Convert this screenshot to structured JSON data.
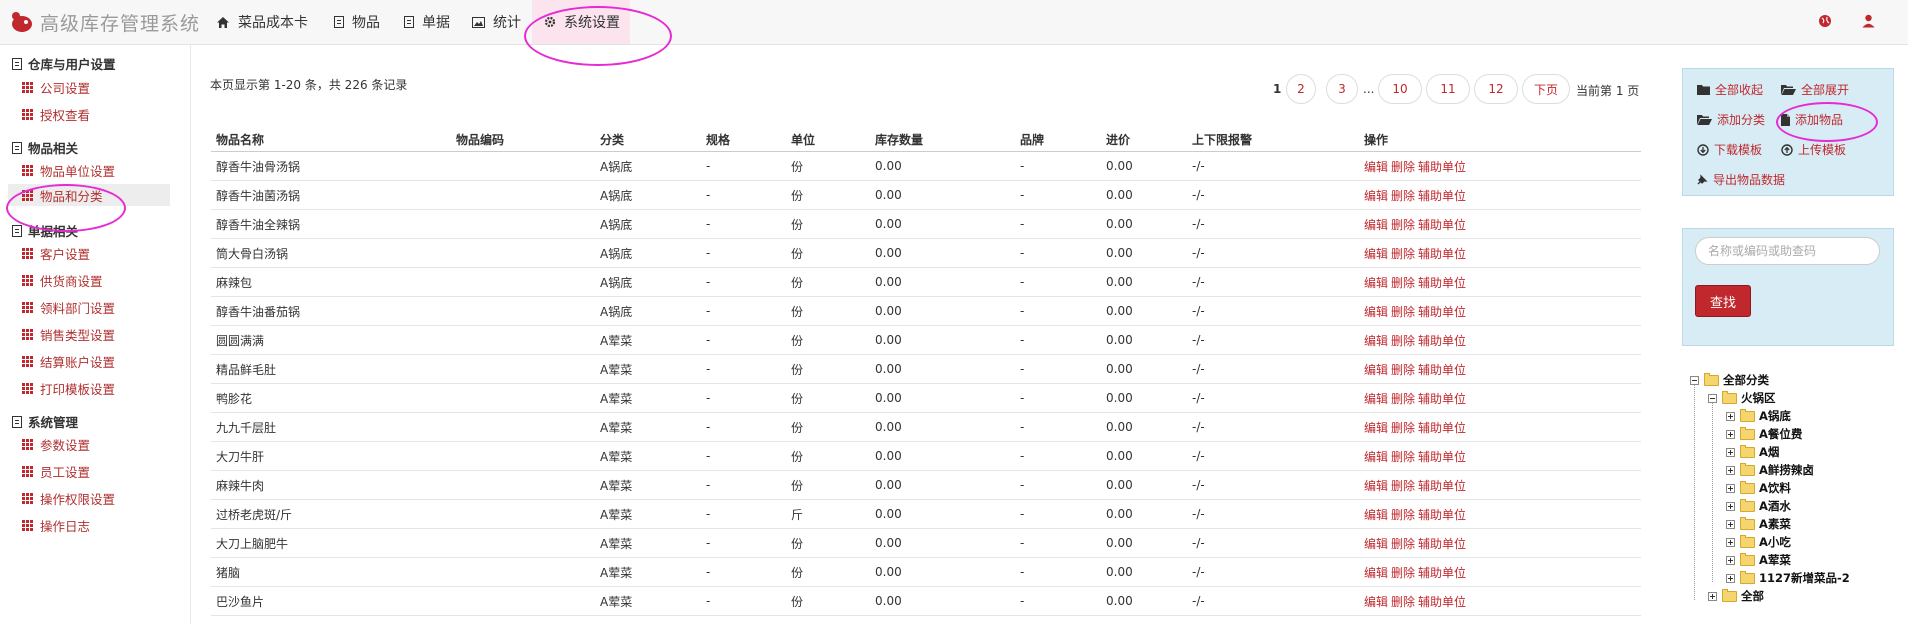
{
  "app": {
    "logo_text": "高级库存管理系统"
  },
  "nav": {
    "items": [
      {
        "label": "菜品成本卡",
        "icon": "home-icon"
      },
      {
        "label": "物品",
        "icon": "book-icon"
      },
      {
        "label": "单据",
        "icon": "book-icon"
      },
      {
        "label": "统计",
        "icon": "image-icon"
      },
      {
        "label": "系统设置",
        "icon": "gear-icon",
        "active": true
      }
    ],
    "right_icons": [
      "globe-icon",
      "user-icon"
    ]
  },
  "sidebar": {
    "groups": [
      {
        "title": "仓库与用户设置",
        "items": [
          "公司设置",
          "授权查看"
        ]
      },
      {
        "title": "物品相关",
        "items": [
          "物品单位设置",
          "物品和分类"
        ]
      },
      {
        "title": "单据相关",
        "items": [
          "客户设置",
          "供货商设置",
          "领料部门设置",
          "销售类型设置",
          "结算账户设置",
          "打印模板设置"
        ]
      },
      {
        "title": "系统管理",
        "items": [
          "参数设置",
          "员工设置",
          "操作权限设置",
          "操作日志"
        ]
      }
    ],
    "active_item": "物品和分类"
  },
  "main": {
    "summary": "本页显示第 1-20 条，共 226 条记录",
    "pagination": {
      "current": "1",
      "pages": [
        "2",
        "3",
        "10",
        "11",
        "12"
      ],
      "dots": "...",
      "next": "下页",
      "status": "当前第 1 页"
    },
    "columns": [
      "物品名称",
      "物品编码",
      "分类",
      "规格",
      "单位",
      "库存数量",
      "品牌",
      "进价",
      "上下限报警",
      "操作"
    ],
    "rows": [
      [
        "醇香牛油骨汤锅",
        "",
        "A锅底",
        "-",
        "份",
        "0.00",
        "-",
        "0.00",
        "-/-"
      ],
      [
        "醇香牛油菌汤锅",
        "",
        "A锅底",
        "-",
        "份",
        "0.00",
        "-",
        "0.00",
        "-/-"
      ],
      [
        "醇香牛油全辣锅",
        "",
        "A锅底",
        "-",
        "份",
        "0.00",
        "-",
        "0.00",
        "-/-"
      ],
      [
        "筒大骨白汤锅",
        "",
        "A锅底",
        "-",
        "份",
        "0.00",
        "-",
        "0.00",
        "-/-"
      ],
      [
        "麻辣包",
        "",
        "A锅底",
        "-",
        "份",
        "0.00",
        "-",
        "0.00",
        "-/-"
      ],
      [
        "醇香牛油番茄锅",
        "",
        "A锅底",
        "-",
        "份",
        "0.00",
        "-",
        "0.00",
        "-/-"
      ],
      [
        "圆圆满满",
        "",
        "A荤菜",
        "-",
        "份",
        "0.00",
        "-",
        "0.00",
        "-/-"
      ],
      [
        "精品鲜毛肚",
        "",
        "A荤菜",
        "-",
        "份",
        "0.00",
        "-",
        "0.00",
        "-/-"
      ],
      [
        "鸭胗花",
        "",
        "A荤菜",
        "-",
        "份",
        "0.00",
        "-",
        "0.00",
        "-/-"
      ],
      [
        "九九千层肚",
        "",
        "A荤菜",
        "-",
        "份",
        "0.00",
        "-",
        "0.00",
        "-/-"
      ],
      [
        "大刀牛肝",
        "",
        "A荤菜",
        "-",
        "份",
        "0.00",
        "-",
        "0.00",
        "-/-"
      ],
      [
        "麻辣牛肉",
        "",
        "A荤菜",
        "-",
        "份",
        "0.00",
        "-",
        "0.00",
        "-/-"
      ],
      [
        "过桥老虎斑/斤",
        "",
        "A荤菜",
        "-",
        "斤",
        "0.00",
        "-",
        "0.00",
        "-/-"
      ],
      [
        "大刀上脑肥牛",
        "",
        "A荤菜",
        "-",
        "份",
        "0.00",
        "-",
        "0.00",
        "-/-"
      ],
      [
        "猪脑",
        "",
        "A荤菜",
        "-",
        "份",
        "0.00",
        "-",
        "0.00",
        "-/-"
      ],
      [
        "巴沙鱼片",
        "",
        "A荤菜",
        "-",
        "份",
        "0.00",
        "-",
        "0.00",
        "-/-"
      ]
    ],
    "row_actions": [
      "编辑",
      "删除",
      "辅助单位"
    ]
  },
  "actions": {
    "collapse_all": "全部收起",
    "expand_all": "全部展开",
    "add_category": "添加分类",
    "add_item": "添加物品",
    "download_template": "下载模板",
    "upload_template": "上传模板",
    "export_data": "导出物品数据"
  },
  "search": {
    "placeholder": "名称或编码或助查码",
    "button": "查找"
  },
  "tree": {
    "root": "全部分类",
    "level1": "火锅区",
    "children": [
      "A锅底",
      "A餐位费",
      "A烟",
      "A鲜捞辣卤",
      "A饮料",
      "A酒水",
      "A素菜",
      "A小吃",
      "A荤菜",
      "1127新增菜品-2"
    ],
    "last": "全部"
  },
  "colors": {
    "accent": "#c0282d",
    "active_nav_bg": "#fce4ee",
    "panel_bg": "#d7ecf5",
    "annotation": "#e62ad4"
  }
}
